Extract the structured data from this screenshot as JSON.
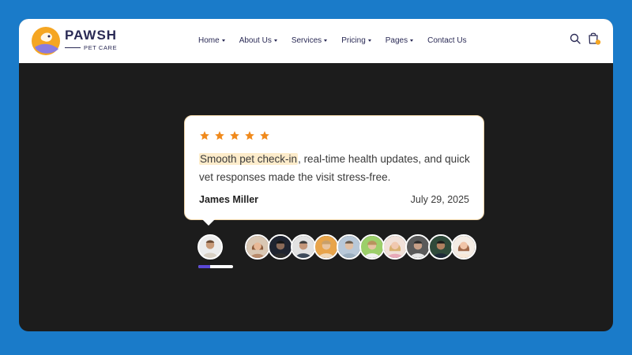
{
  "brand": {
    "name": "PAWSH",
    "tagline": "PET CARE"
  },
  "nav": {
    "items": [
      {
        "label": "Home",
        "dropdown": true
      },
      {
        "label": "About Us",
        "dropdown": true
      },
      {
        "label": "Services",
        "dropdown": true
      },
      {
        "label": "Pricing",
        "dropdown": true
      },
      {
        "label": "Pages",
        "dropdown": true
      },
      {
        "label": "Contact Us",
        "dropdown": false
      }
    ],
    "search_icon": "search-icon",
    "cart_icon": "shopping-bag-icon"
  },
  "testimonial": {
    "rating": 5,
    "quote_highlight": "Smooth pet check-in",
    "quote_rest": ", real-time health updates, and quick vet responses made the visit stress-free.",
    "author": "James Miller",
    "date": "July 29, 2025"
  },
  "slider": {
    "active_index": 0,
    "progress": 0.33,
    "avatar_count": 11
  },
  "colors": {
    "page_bg": "#1a7bc9",
    "content_bg": "#1c1c1c",
    "brand_text": "#2a2a55",
    "star": "#f08a1c",
    "highlight": "#fdeccb",
    "progress": "#5b48d6",
    "logo_orange": "#f5a623",
    "logo_purple": "#8a7be0"
  }
}
